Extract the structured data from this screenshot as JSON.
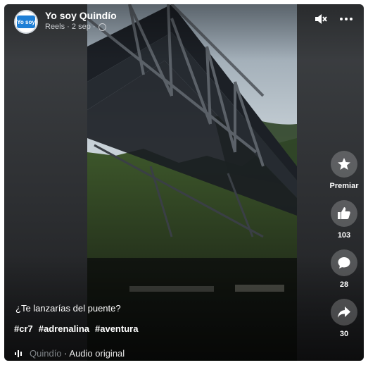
{
  "post": {
    "page_name": "Yo soy Quindío",
    "meta": "Reels · 2 sep · ",
    "avatar_text": "Yo soy"
  },
  "caption": "¿Te lanzarías del puente?",
  "hashtags": [
    "#cr7",
    "#adrenalina",
    "#aventura"
  ],
  "audio": {
    "source": "Quindío",
    "label": "· Audio original"
  },
  "actions": {
    "award_label": "Premiar",
    "like_count": "103",
    "comment_count": "28",
    "share_count": "30"
  },
  "icons": {
    "mute": "speaker-muted-icon",
    "more": "more-dots-icon",
    "award": "award-star-icon",
    "like": "thumbs-up-icon",
    "comment": "comment-bubble-icon",
    "share": "share-arrow-icon",
    "audio": "audio-wave-icon",
    "privacy": "globe-icon"
  },
  "colors": {
    "background": "#2d2f32",
    "text": "#ffffff",
    "muted_text": "#c9ccd0"
  }
}
